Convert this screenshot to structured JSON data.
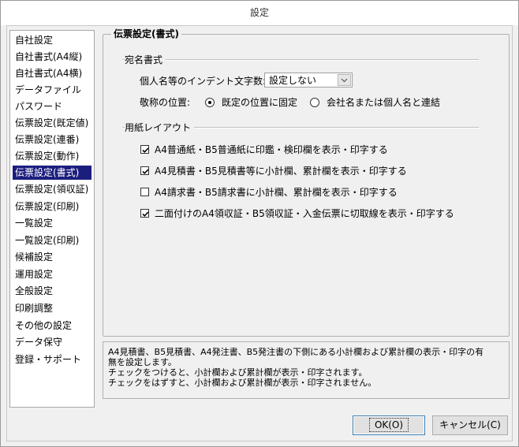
{
  "window": {
    "title": "設定"
  },
  "sidebar": {
    "items": [
      {
        "label": "自社設定",
        "selected": false
      },
      {
        "label": "自社書式(A4縦)",
        "selected": false
      },
      {
        "label": "自社書式(A4横)",
        "selected": false
      },
      {
        "label": "データファイル",
        "selected": false
      },
      {
        "label": "パスワード",
        "selected": false
      },
      {
        "label": "伝票設定(既定値)",
        "selected": false
      },
      {
        "label": "伝票設定(連番)",
        "selected": false
      },
      {
        "label": "伝票設定(動作)",
        "selected": false
      },
      {
        "label": "伝票設定(書式)",
        "selected": true
      },
      {
        "label": "伝票設定(領収証)",
        "selected": false
      },
      {
        "label": "伝票設定(印刷)",
        "selected": false
      },
      {
        "label": "一覧設定",
        "selected": false
      },
      {
        "label": "一覧設定(印刷)",
        "selected": false
      },
      {
        "label": "候補設定",
        "selected": false
      },
      {
        "label": "運用設定",
        "selected": false
      },
      {
        "label": "全般設定",
        "selected": false
      },
      {
        "label": "印刷調整",
        "selected": false
      },
      {
        "label": "その他の設定",
        "selected": false
      },
      {
        "label": "データ保守",
        "selected": false
      },
      {
        "label": "登録・サポート",
        "selected": false
      }
    ]
  },
  "panel": {
    "title": "伝票設定(書式)",
    "address_section": {
      "label": "宛名書式",
      "indent_label": "個人名等のインデント文字数:",
      "indent_value": "設定しない",
      "position_label": "敬称の位置:",
      "radio_default": "既定の位置に固定",
      "radio_linked": "会社名または個人名と連結",
      "selected_radio": "default"
    },
    "layout_section": {
      "label": "用紙レイアウト",
      "checkboxes": [
        {
          "label": "A4普通紙・B5普通紙に印鑑・検印欄を表示・印字する",
          "checked": true
        },
        {
          "label": "A4見積書・B5見積書等に小計欄、累計欄を表示・印字する",
          "checked": true
        },
        {
          "label": "A4請求書・B5請求書に小計欄、累計欄を表示・印字する",
          "checked": false
        },
        {
          "label": "二面付けのA4領収証・B5領収証・入金伝票に切取線を表示・印字する",
          "checked": true
        }
      ]
    }
  },
  "description": {
    "lines": [
      "A4見積書、B5見積書、A4発注書、B5発注書の下側にある小計欄および累計欄の表示・印字の有",
      "無を設定します。",
      "チェックをつけると、小計欄および累計欄が表示・印字されます。",
      "チェックをはずすと、小計欄および累計欄が表示・印字されません。"
    ]
  },
  "buttons": {
    "ok": "OK(O)",
    "cancel": "キャンセル(C)"
  }
}
